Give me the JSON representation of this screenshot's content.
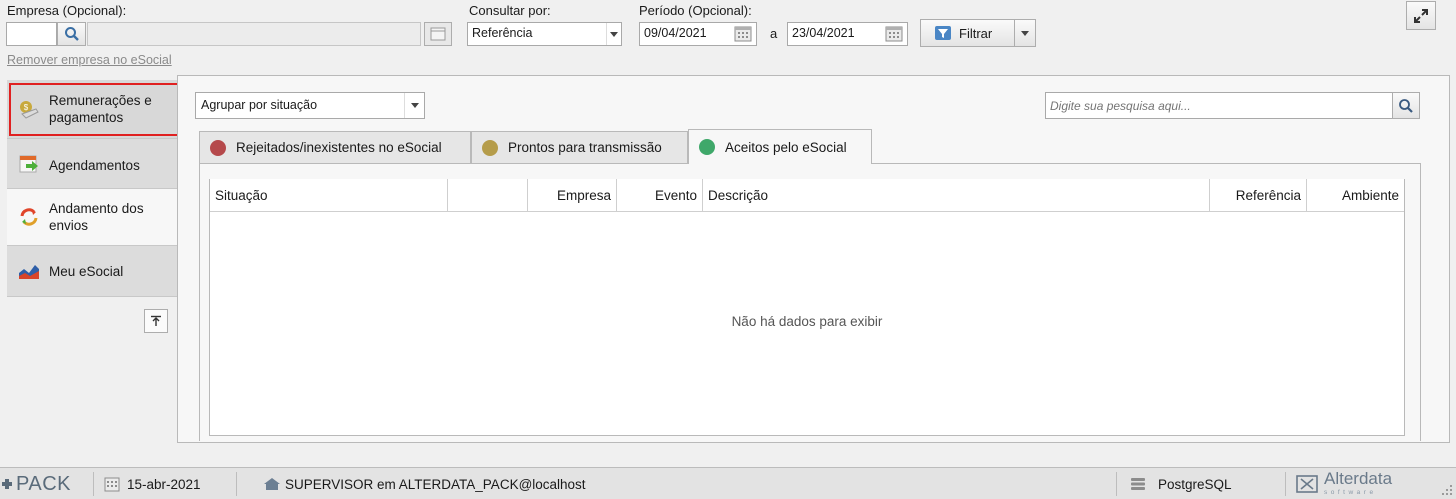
{
  "filters": {
    "empresa_label": "Empresa (Opcional):",
    "empresa_code_value": "",
    "empresa_name_value": "",
    "remover_link": "Remover empresa no eSocial",
    "consultar_label": "Consultar por:",
    "consultar_value": "Referência",
    "periodo_label": "Período (Opcional):",
    "periodo_start": "09/04/2021",
    "periodo_sep": "a",
    "periodo_end": "23/04/2021",
    "filtrar_label": "Filtrar"
  },
  "sidebar": {
    "items": [
      {
        "label_line1": "Remunerações e",
        "label_line2": "pagamentos",
        "icon": "money-icon",
        "selected": true
      },
      {
        "label_line1": "Agendamentos",
        "label_line2": "",
        "icon": "calendar-arrow-icon"
      },
      {
        "label_line1": "Andamento dos",
        "label_line2": "envios",
        "icon": "progress-icon"
      },
      {
        "label_line1": "Meu eSocial",
        "label_line2": "",
        "icon": "chart-icon"
      }
    ]
  },
  "main": {
    "group_by_value": "Agrupar por situação",
    "search_placeholder": "Digite sua pesquisa aqui...",
    "tabs": [
      {
        "label": "Rejeitados/inexistentes no eSocial",
        "color": "#b5494b"
      },
      {
        "label": "Prontos para transmissão",
        "color": "#b59c4a"
      },
      {
        "label": "Aceitos pelo eSocial",
        "color": "#3fa86a",
        "active": true
      }
    ],
    "columns": [
      "Situação",
      "",
      "Empresa",
      "Evento",
      "Descrição",
      "Referência",
      "Ambiente"
    ],
    "empty_message": "Não há dados para exibir"
  },
  "statusbar": {
    "brand": "PACK",
    "date": "15-abr-2021",
    "user": "SUPERVISOR em ALTERDATA_PACK@localhost",
    "db": "PostgreSQL",
    "vendor": "Alterdata",
    "vendor_sub": "software"
  }
}
